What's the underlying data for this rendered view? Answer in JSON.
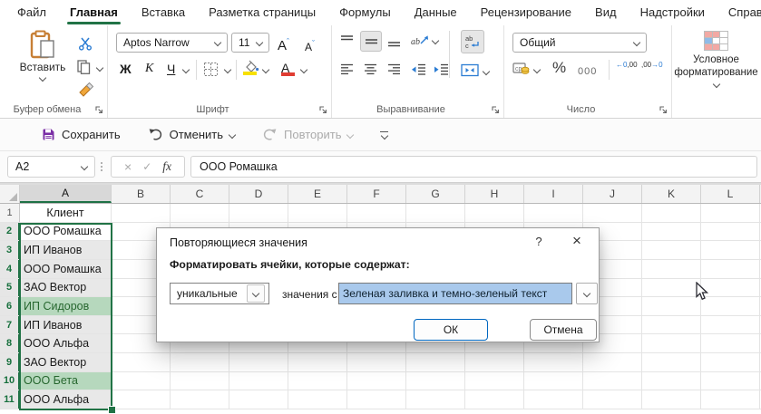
{
  "tabs": {
    "items": [
      "Файл",
      "Главная",
      "Вставка",
      "Разметка страницы",
      "Формулы",
      "Данные",
      "Рецензирование",
      "Вид",
      "Надстройки",
      "Справка"
    ],
    "active": "Главная"
  },
  "ribbon": {
    "clipboard": {
      "paste": "Вставить",
      "group": "Буфер обмена"
    },
    "font": {
      "name": "Aptos Narrow",
      "size": "11",
      "bold": "Ж",
      "italic": "К",
      "underline": "Ч",
      "grow": "А",
      "shrink": "А",
      "color_letter": "А",
      "group": "Шрифт",
      "fill_color": "#f7e000",
      "font_color": "#e03c32"
    },
    "alignment": {
      "orient_ab": "ab",
      "wrap_ab": "ab",
      "group": "Выравнивание"
    },
    "number": {
      "format": "Общий",
      "percent": "%",
      "thousands": "000",
      "inc_top": "←0",
      "inc_bottom": ",00",
      "dec_top": ",00",
      "dec_bottom": "→0",
      "group": "Число"
    },
    "styles": {
      "cond_format": "Условное форматирование"
    }
  },
  "qat": {
    "save": "Сохранить",
    "undo": "Отменить",
    "redo": "Повторить"
  },
  "formula": {
    "name_box": "A2",
    "cancel": "×",
    "enter": "✓",
    "fx": "fx",
    "value": "ООО Ромашка"
  },
  "sheet": {
    "columns": [
      "A",
      "B",
      "C",
      "D",
      "E",
      "F",
      "G",
      "H",
      "I",
      "J",
      "K",
      "L"
    ],
    "selected_column": "A",
    "selected_range": "A2:A11",
    "rows": [
      {
        "num": "1",
        "a": "Клиент"
      },
      {
        "num": "2",
        "a": "ООО Ромашка"
      },
      {
        "num": "3",
        "a": "ИП Иванов"
      },
      {
        "num": "4",
        "a": "ООО Ромашка"
      },
      {
        "num": "5",
        "a": "ЗАО Вектор"
      },
      {
        "num": "6",
        "a": "ИП Сидоров"
      },
      {
        "num": "7",
        "a": "ИП Иванов"
      },
      {
        "num": "8",
        "a": "ООО Альфа"
      },
      {
        "num": "9",
        "a": "ЗАО Вектор"
      },
      {
        "num": "10",
        "a": "ООО Бета"
      },
      {
        "num": "11",
        "a": "ООО Альфа"
      }
    ],
    "colors": {
      "accent_green": "#217346",
      "unique_fill": "#b6d8bd",
      "unique_text": "#27672f",
      "selection_tint": "#e8e8e8"
    }
  },
  "dialog": {
    "title": "Повторяющиеся значения",
    "help": "?",
    "close": "×",
    "label": "Форматировать ячейки, которые содержат:",
    "rule_type": "уникальные",
    "middle_label": "значения с",
    "format_value": "Зеленая заливка и темно-зеленый текст",
    "ok": "ОК",
    "cancel": "Отмена",
    "highlight_color": "#a9c9ec",
    "ok_border_color": "#0067c0"
  }
}
